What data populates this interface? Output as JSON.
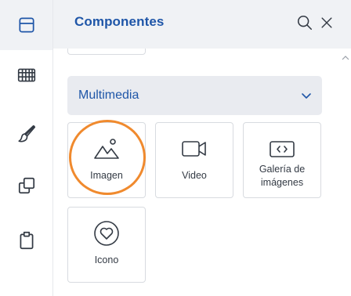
{
  "header": {
    "title": "Componentes",
    "search_icon": "search-icon",
    "close_icon": "close-icon"
  },
  "sidebar": {
    "items": [
      {
        "icon": "layout-icon",
        "active": true
      },
      {
        "icon": "grid-icon",
        "active": false
      },
      {
        "icon": "brush-icon",
        "active": false
      },
      {
        "icon": "copy-icon",
        "active": false
      },
      {
        "icon": "clipboard-icon",
        "active": false
      }
    ]
  },
  "section": {
    "label": "Multimedia",
    "expanded": true
  },
  "components": [
    {
      "label": "Imagen",
      "icon": "image-icon"
    },
    {
      "label": "Video",
      "icon": "video-icon"
    },
    {
      "label": "Galería de imágenes",
      "icon": "gallery-icon"
    },
    {
      "label": "Icono",
      "icon": "heart-icon"
    }
  ],
  "colors": {
    "accent": "#1f56a8",
    "highlight": "#f08a2e",
    "header_bg": "#f0f2f5",
    "section_bg": "#e9ebf0"
  }
}
